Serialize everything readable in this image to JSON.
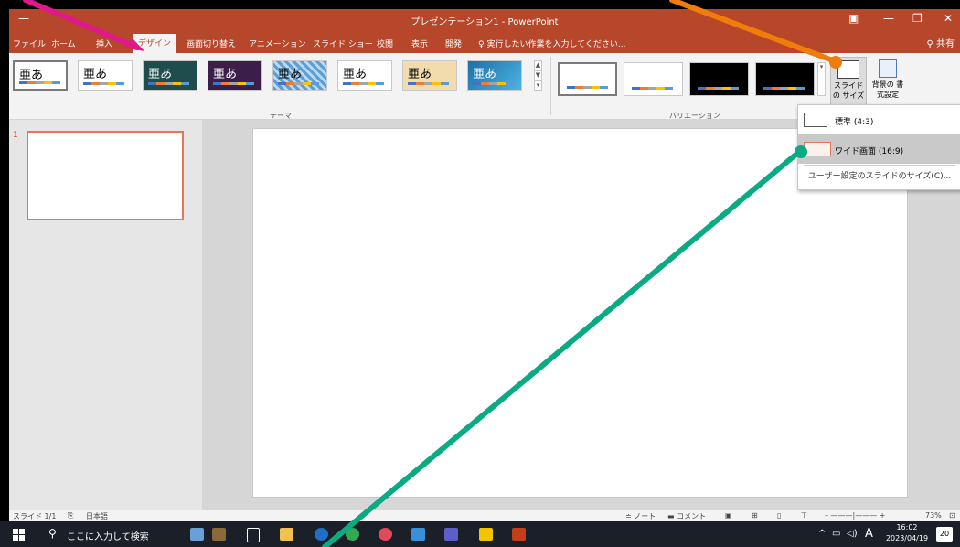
{
  "window": {
    "title": "プレゼンテーション1 - PowerPoint",
    "controls": [
      "ribbon-options",
      "minimize",
      "restore",
      "close"
    ]
  },
  "tabs": [
    {
      "label": "ファイル"
    },
    {
      "label": "ホーム"
    },
    {
      "label": "挿入"
    },
    {
      "label": "デザイン",
      "active": true
    },
    {
      "label": "画面切り替え"
    },
    {
      "label": "アニメーション"
    },
    {
      "label": "スライド ショー"
    },
    {
      "label": "校閲"
    },
    {
      "label": "表示"
    },
    {
      "label": "開発"
    }
  ],
  "tellme": "実行したい作業を入力してください...",
  "share": "共有",
  "ribbon": {
    "themes_label": "テーマ",
    "variants_label": "バリエーション",
    "theme_text": "亜あ",
    "theme_count": 8,
    "variant_count": 4,
    "slide_size_button": "スライドの サイズ",
    "background_button": "背景の 書式設定"
  },
  "dropdown": {
    "items": [
      {
        "label": "標準 (4:3)"
      },
      {
        "label": "ワイド画面 (16:9)",
        "hovered": true
      }
    ],
    "custom": "ユーザー設定のスライドのサイズ(C)..."
  },
  "thumbnails": [
    {
      "number": "1"
    }
  ],
  "statusbar": {
    "slide": "スライド 1/1",
    "language": "日本語",
    "notes": "ノート",
    "comments": "コメント",
    "zoom": "73%"
  },
  "taskbar": {
    "search": "ここに入力して検索",
    "time": "16:02",
    "date": "2023/04/19",
    "ime": "A",
    "notifications": "20"
  },
  "colors": {
    "accent": "#b7472a",
    "arrow_pink": "#e0198a",
    "arrow_orange": "#f07d0a",
    "arrow_green": "#0aaa82"
  }
}
